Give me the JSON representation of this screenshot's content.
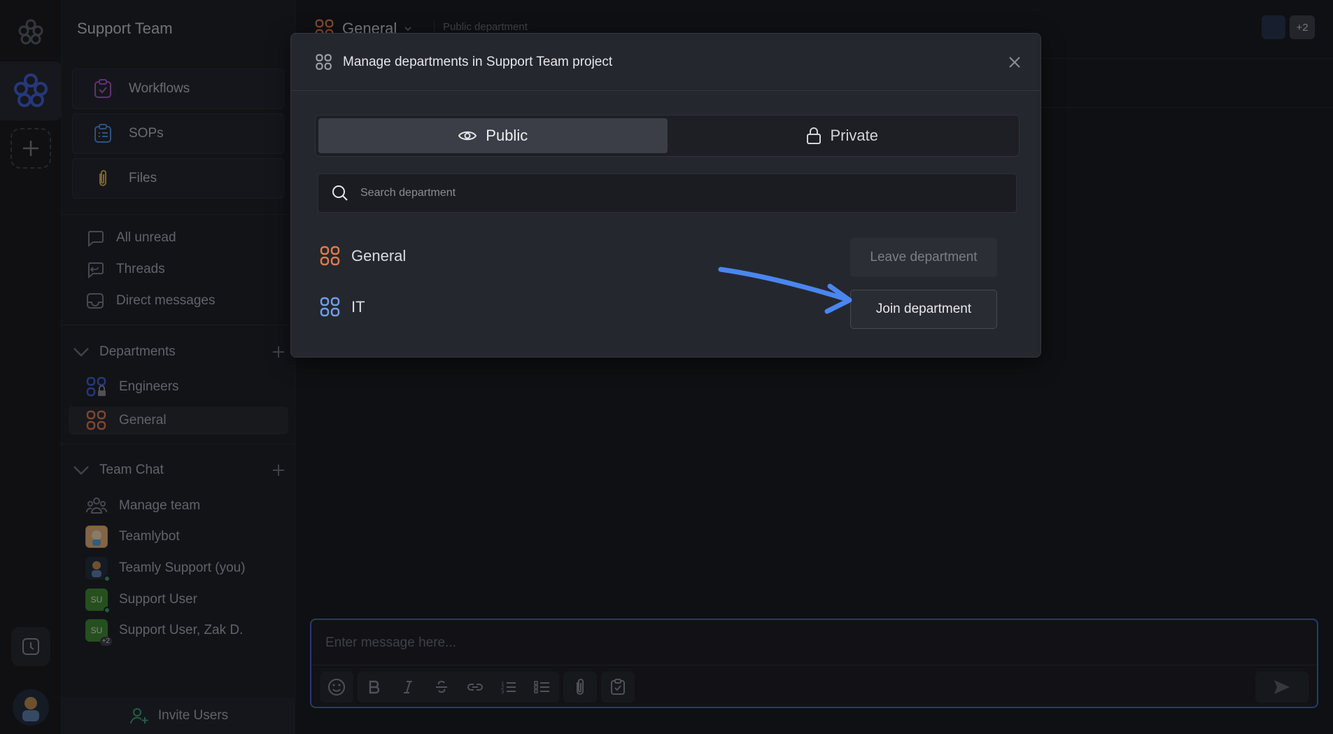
{
  "sidebar": {
    "title": "Support Team",
    "features": [
      {
        "label": "Workflows",
        "icon": "workflows-icon"
      },
      {
        "label": "SOPs",
        "icon": "sops-icon"
      },
      {
        "label": "Files",
        "icon": "paperclip-icon"
      }
    ],
    "quick": [
      {
        "label": "All unread",
        "icon": "chat-bubble-icon"
      },
      {
        "label": "Threads",
        "icon": "threads-icon"
      },
      {
        "label": "Direct messages",
        "icon": "inbox-icon"
      }
    ],
    "departments_header": "Departments",
    "departments": [
      {
        "label": "Engineers"
      },
      {
        "label": "General"
      }
    ],
    "team_chat_header": "Team Chat",
    "team_chat": [
      {
        "label": "Manage team"
      },
      {
        "label": "Teamlybot"
      },
      {
        "label": "Teamly Support (you)"
      },
      {
        "label": "Support User",
        "avatar_text": "SU"
      },
      {
        "label": "Support User, Zak D.",
        "avatar_text": "SU",
        "badge": "+2"
      }
    ],
    "invite_label": "Invite Users"
  },
  "topbar": {
    "channel": "General",
    "description": "Public department",
    "extra_users": "+2"
  },
  "composer": {
    "placeholder": "Enter message here..."
  },
  "modal": {
    "title": "Manage departments in Support Team project",
    "tabs": [
      {
        "label": "Public",
        "selected": true
      },
      {
        "label": "Private",
        "selected": false
      }
    ],
    "search_placeholder": "Search department",
    "departments": [
      {
        "name": "General",
        "action": "Leave department",
        "color": "#e07a4a"
      },
      {
        "name": "IT",
        "action": "Join department",
        "color": "#6f9fe8"
      }
    ]
  },
  "colors": {
    "accent_blue": "#3f63c7",
    "arrow_blue": "#4a86f0",
    "general_orange": "#e07a4a",
    "workflows_purple": "#b04fd6",
    "sops_blue": "#4d8ee0",
    "files_gold": "#d8b24a"
  }
}
